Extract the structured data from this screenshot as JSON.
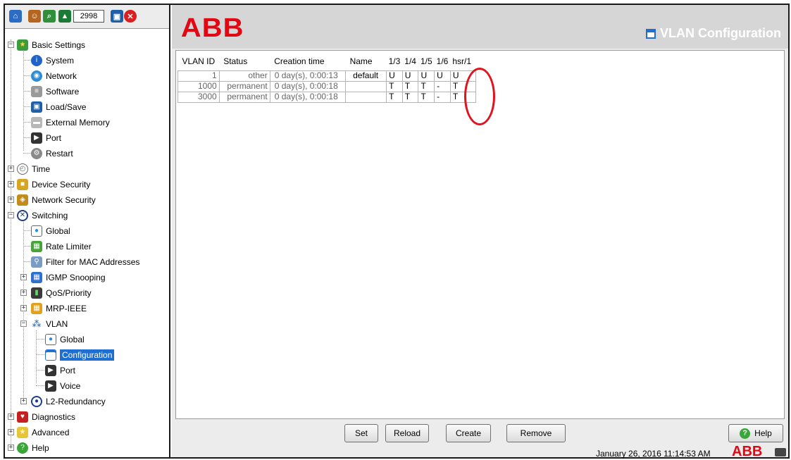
{
  "toolbar": {
    "counter": "2998",
    "icons": [
      "home-icon",
      "users-icon",
      "search-icon",
      "upload-icon",
      "save-icon",
      "close-icon"
    ]
  },
  "tree": {
    "basic_settings": "Basic Settings",
    "system": "System",
    "network": "Network",
    "software": "Software",
    "load_save": "Load/Save",
    "external_memory": "External Memory",
    "port": "Port",
    "restart": "Restart",
    "time": "Time",
    "device_security": "Device Security",
    "network_security": "Network Security",
    "switching": "Switching",
    "global": "Global",
    "rate_limiter": "Rate Limiter",
    "filter_mac": "Filter for MAC Addresses",
    "igmp": "IGMP Snooping",
    "qos": "QoS/Priority",
    "mrp": "MRP-IEEE",
    "vlan": "VLAN",
    "vlan_global": "Global",
    "vlan_configuration": "Configuration",
    "vlan_port": "Port",
    "vlan_voice": "Voice",
    "l2_redundancy": "L2-Redundancy",
    "diagnostics": "Diagnostics",
    "advanced": "Advanced",
    "help": "Help"
  },
  "header": {
    "logo": "ABB",
    "title": "VLAN Configuration"
  },
  "table": {
    "columns": [
      "VLAN ID",
      "Status",
      "Creation time",
      "Name",
      "1/3",
      "1/4",
      "1/5",
      "1/6",
      "hsr/1"
    ],
    "rows": [
      [
        "1",
        "other",
        "0 day(s), 0:00:13",
        "default",
        "U",
        "U",
        "U",
        "U",
        "U"
      ],
      [
        "1000",
        "permanent",
        "0 day(s), 0:00:18",
        "",
        "T",
        "T",
        "T",
        "-",
        "T"
      ],
      [
        "3000",
        "permanent",
        "0 day(s), 0:00:18",
        "",
        "T",
        "T",
        "T",
        "-",
        "T"
      ]
    ]
  },
  "buttons": {
    "set": "Set",
    "reload": "Reload",
    "create": "Create",
    "remove": "Remove",
    "help": "Help"
  },
  "status": {
    "datetime": "January 26, 2016 11:14:53 AM",
    "logo": "ABB"
  },
  "colors": {
    "brand_red": "#e30613",
    "selection_blue": "#1f6fd3",
    "annotation_red": "#e0141e"
  }
}
